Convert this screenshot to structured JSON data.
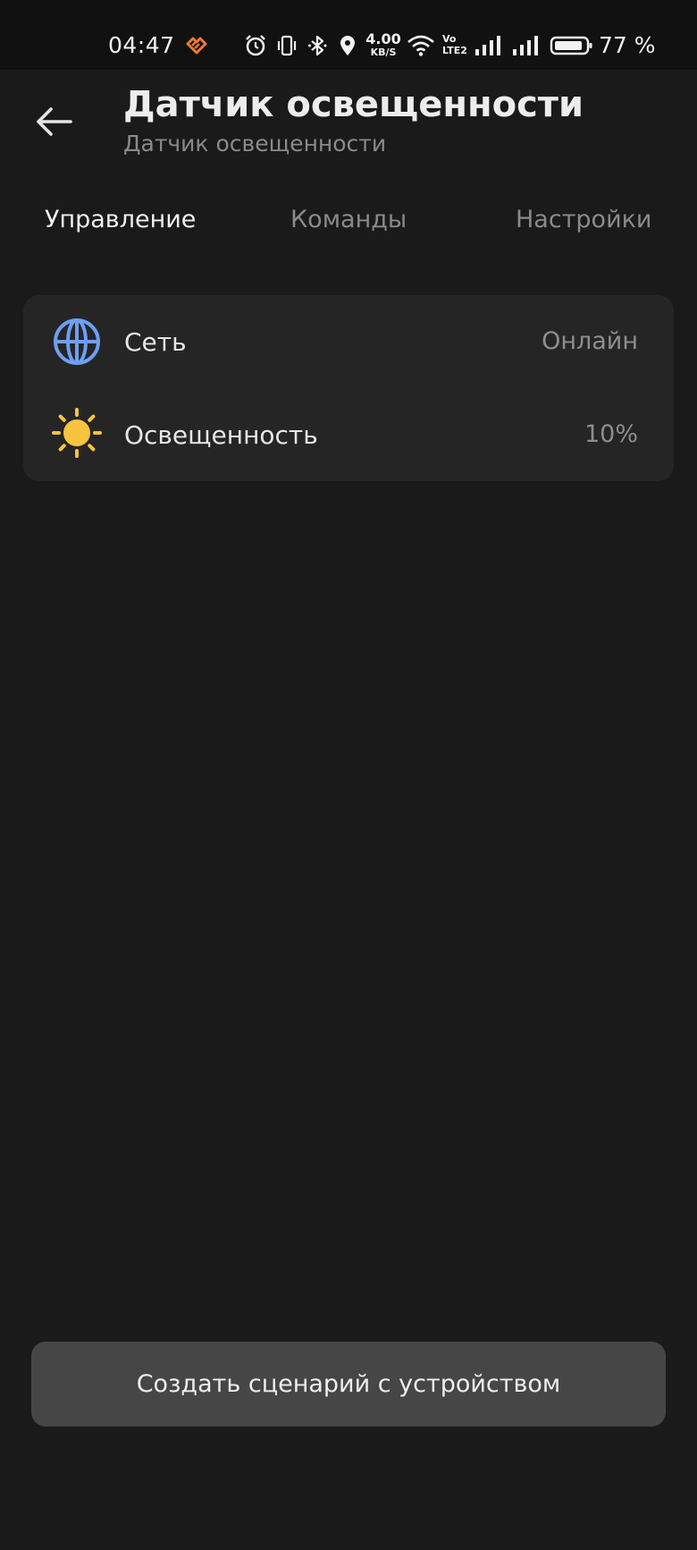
{
  "status_bar": {
    "time": "04:47",
    "network_speed": "4.00",
    "network_speed_unit": "KB/S",
    "volte_top": "Vo",
    "volte_bottom": "LTE2",
    "battery_percent": "77 %",
    "icons": [
      "app-notification-icon",
      "alarm-icon",
      "vibrate-icon",
      "bluetooth-icon",
      "location-icon",
      "wifi-icon",
      "signal-icon",
      "signal-icon",
      "battery-icon"
    ],
    "app_icon_color": "#f07a2a"
  },
  "header": {
    "title": "Датчик освещенности",
    "subtitle": "Датчик освещенности",
    "back_icon": "arrow-left-icon"
  },
  "tabs": [
    {
      "label": "Управление",
      "active": true
    },
    {
      "label": "Команды",
      "active": false
    },
    {
      "label": "Настройки",
      "active": false
    }
  ],
  "properties": [
    {
      "icon": "globe-icon",
      "label": "Сеть",
      "value": "Онлайн",
      "icon_color": "#6d9ff2"
    },
    {
      "icon": "sun-icon",
      "label": "Освещенность",
      "value": "10%",
      "icon_color": "#f7c340"
    }
  ],
  "actions": {
    "create_scenario_label": "Создать сценарий с устройством"
  }
}
